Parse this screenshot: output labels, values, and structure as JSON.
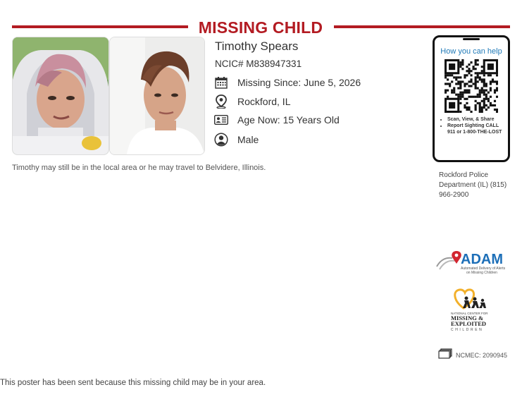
{
  "poster": {
    "title": "MISSING CHILD",
    "name": "Timothy Spears",
    "ncic": "NCIC# M838947331",
    "missing_since": "Missing Since: June 5, 2026",
    "location": "Rockford, IL",
    "age": "Age Now: 15 Years Old",
    "sex": "Male",
    "description": "Timothy may still be in the local area or he may travel to Belvidere, Illinois.",
    "accent_color": "#b31b22"
  },
  "help_panel": {
    "heading": "How you can help",
    "bullets": [
      "Scan, View, & Share",
      "Report Sighting CALL 911 or 1-800-THE-LOST"
    ]
  },
  "agency": "Rockford Police Department (IL) (815) 966-2900",
  "logos": {
    "adam": "ADAM",
    "adam_sub1": "Automated Delivery of Alerts",
    "adam_sub2": "on Missing Children",
    "ncmec_line1": "NATIONAL CENTER FOR",
    "ncmec_line2": "MISSING &",
    "ncmec_line3": "EXPLOITED",
    "ncmec_line4": "CHILDREN"
  },
  "case_number": "NCMEC: 2090945",
  "footer": "This poster has been sent because this missing child may be in your area.",
  "icons": [
    "calendar-icon",
    "map-pin-icon",
    "id-card-icon",
    "person-icon",
    "qr-code",
    "folder-icon"
  ]
}
